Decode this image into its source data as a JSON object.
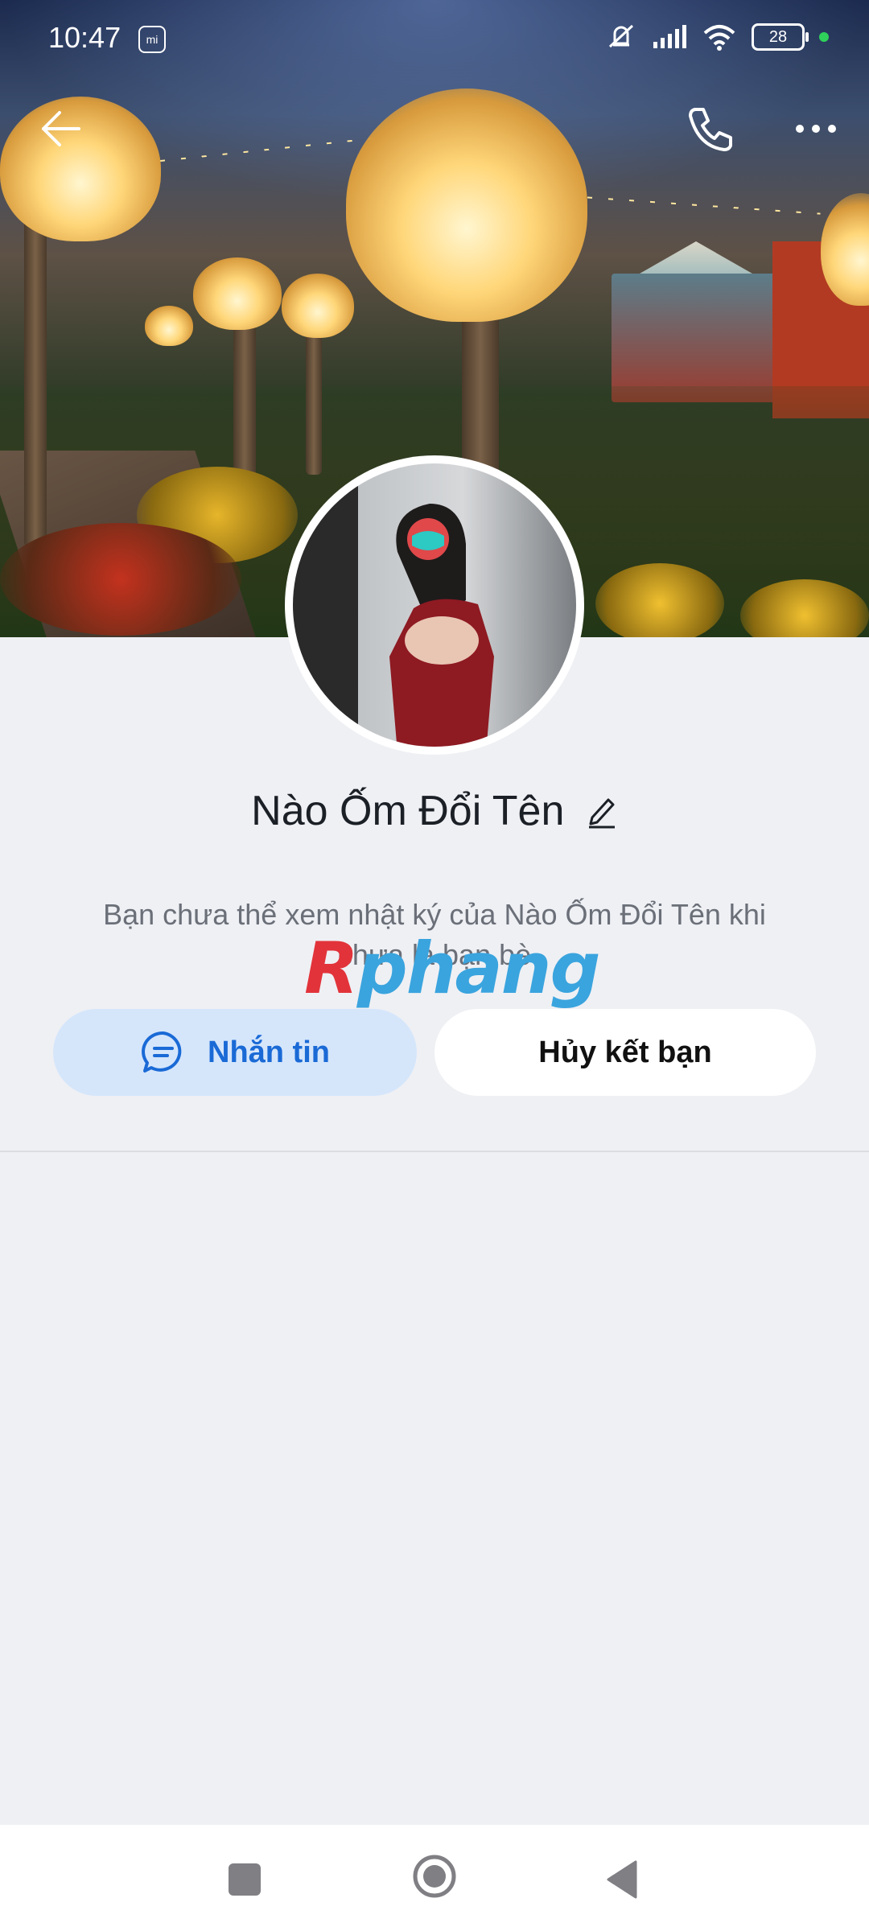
{
  "status_bar": {
    "time": "10:47",
    "mi_badge": "mi",
    "battery": "28",
    "icons": [
      "mute-icon",
      "signal-icon",
      "wifi-icon",
      "battery-icon",
      "active-dot"
    ]
  },
  "top_nav": {
    "back_icon": "arrow-left-icon",
    "call_icon": "phone-icon",
    "more_icon": "more-dots-icon"
  },
  "profile": {
    "name": "Nào Ốm Đổi Tên",
    "edit_icon": "pencil-icon",
    "notice": "Bạn chưa thể xem nhật ký của Nào Ốm Đổi Tên khi chưa là bạn bè"
  },
  "watermark": {
    "part1": "R",
    "part2": "phang"
  },
  "actions": {
    "message_label": "Nhắn tin",
    "message_icon": "chat-bubble-icon",
    "unfriend_label": "Hủy kết bạn"
  },
  "colors": {
    "accent": "#1a6ad6",
    "message_button_bg": "#d5e6fb",
    "page_bg": "#eff0f4"
  },
  "system_nav": {
    "icons": [
      "recents-square-icon",
      "home-circle-icon",
      "back-triangle-icon"
    ]
  }
}
